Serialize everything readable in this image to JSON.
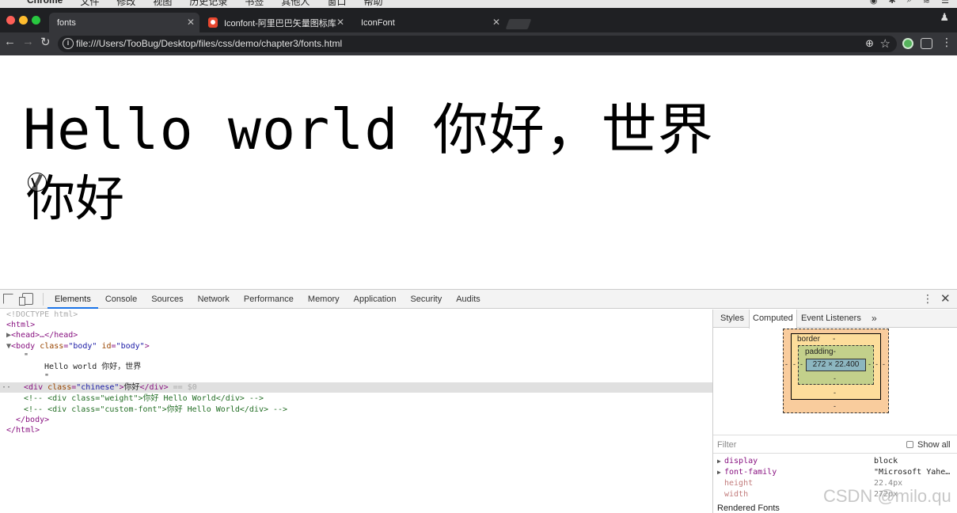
{
  "menubar": {
    "app": "Chrome",
    "items": [
      "文件",
      "修改",
      "视图",
      "历史记录",
      "书签",
      "其他人",
      "窗口",
      "帮助"
    ]
  },
  "tabs": [
    {
      "title": "fonts",
      "icon": "page-icon",
      "active": true
    },
    {
      "title": "Iconfont-阿里巴巴矢量图标库",
      "icon": "iconfont-logo-icon",
      "active": false
    },
    {
      "title": "IconFont",
      "icon": "page-icon",
      "active": false
    }
  ],
  "address_bar": {
    "url": "file:///Users/TooBug/Desktop/files/css/demo/chapter3/fonts.html"
  },
  "page": {
    "heading": "Hello world 你好，世界",
    "chinese_line": "你好"
  },
  "devtools": {
    "tabs": [
      "Elements",
      "Console",
      "Sources",
      "Network",
      "Performance",
      "Memory",
      "Application",
      "Security",
      "Audits"
    ],
    "active_tab": "Elements",
    "dom": {
      "doctype": "<!DOCTYPE html>",
      "html_open": "<html>",
      "head": "<head>…</head>",
      "body_tag": "body",
      "body_class_attr": "class",
      "body_class_val": "\"body\"",
      "body_id_attr": "id",
      "body_id_val": "\"body\"",
      "text_quote_open": "\"",
      "text_node": "Hello world 你好，世界",
      "text_quote_close": "\"",
      "div_tag": "div",
      "div_class_attr": "class",
      "div_class_val": "\"chinese\"",
      "div_text": "你好",
      "div_close": "</div>",
      "selected_marker": "== $0",
      "comment1": "<!-- <div class=\"weight\">你好 Hello World</div> -->",
      "comment2": "<!-- <div class=\"custom-font\">你好 Hello World</div> -->",
      "body_close": "</body>",
      "html_close": "</html>"
    },
    "sidebar": {
      "tabs": [
        "Styles",
        "Computed",
        "Event Listeners",
        "»"
      ],
      "active_tab": "Computed",
      "box_model": {
        "border_label": "border",
        "border_value": "-",
        "padding_label": "padding-",
        "content_size": "272 × 22.400",
        "dash": "-"
      },
      "filter_placeholder": "Filter",
      "show_all_label": "Show all",
      "properties": [
        {
          "name": "display",
          "value": "block",
          "expandable": true,
          "dim": false
        },
        {
          "name": "font-family",
          "value": "\"Microsoft Yahe…",
          "expandable": true,
          "dim": false
        },
        {
          "name": "height",
          "value": "22.4px",
          "expandable": false,
          "dim": true
        },
        {
          "name": "width",
          "value": "272px",
          "expandable": false,
          "dim": true
        }
      ],
      "rendered_fonts_label": "Rendered Fonts"
    }
  },
  "watermark": "CSDN @milo.qu"
}
